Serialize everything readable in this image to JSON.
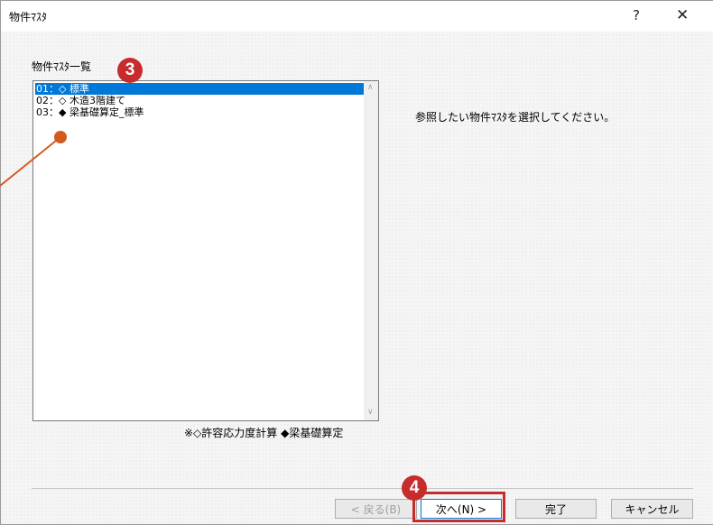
{
  "window": {
    "title": "物件ﾏｽﾀ",
    "help_label": "?",
    "close_label": "✕"
  },
  "group": {
    "label": "物件ﾏｽﾀ一覧"
  },
  "list": {
    "items": [
      {
        "label": "01：◇ 標準",
        "selected": true
      },
      {
        "label": "02：◇ 木造3階建て",
        "selected": false
      },
      {
        "label": "03：◆ 梁基礎算定_標準",
        "selected": false
      }
    ]
  },
  "legend_note": "※◇許容応力度計算 ◆梁基礎算定",
  "message": "参照したい物件ﾏｽﾀを選択してください。",
  "buttons": {
    "back": "< 戻る(B)",
    "next": "次へ(N) >",
    "finish": "完了",
    "cancel": "キャンセル"
  },
  "callouts": {
    "step3": "3",
    "step4": "4",
    "accent_color": "#c72c2c"
  },
  "icons": {
    "scroll_up": "chevron-up-icon",
    "scroll_down": "chevron-down-icon"
  }
}
